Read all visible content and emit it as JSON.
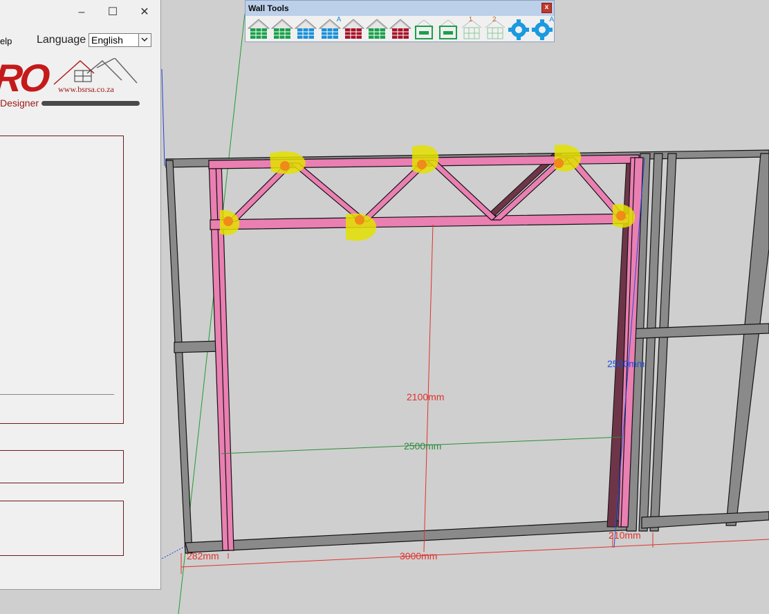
{
  "plugin": {
    "menu_help": "elp",
    "language_label": "Language",
    "language_value": "English",
    "logo_text": "RO",
    "url": "www.bsrsa.co.za",
    "designer": "Designer",
    "window_controls": {
      "minimize": "–",
      "maximize": "☐",
      "close": "✕"
    }
  },
  "walltools": {
    "title": "Wall Tools",
    "close": "x",
    "tools": [
      {
        "name": "wall-green-icon",
        "color": "#1aa04a"
      },
      {
        "name": "wall-green-icon",
        "color": "#1aa04a"
      },
      {
        "name": "wall-blue-icon",
        "color": "#1b8fd6"
      },
      {
        "name": "wall-blue-auto-icon",
        "color": "#1b8fd6",
        "badge": "A"
      },
      {
        "name": "wall-red-icon",
        "color": "#a5142a"
      },
      {
        "name": "wall-green-icon",
        "color": "#1aa04a"
      },
      {
        "name": "wall-red-icon",
        "color": "#a5142a"
      },
      {
        "name": "opening-icon",
        "color": "#1aa04a"
      },
      {
        "name": "window-icon",
        "color": "#1aa04a"
      },
      {
        "name": "grid-1-icon",
        "color": "#8cc79a",
        "badge": "1"
      },
      {
        "name": "grid-2-icon",
        "color": "#8cc79a",
        "badge": "2"
      },
      {
        "name": "gear-icon",
        "color": "#1b9ae0"
      },
      {
        "name": "gear-auto-icon",
        "color": "#1b9ae0",
        "badge": "A"
      }
    ]
  },
  "dimensions": {
    "height_center": "2100mm",
    "width_inner": "2500mm",
    "height_right": "2500mm",
    "width_bottom": "3000mm",
    "offset_left": "282mm",
    "offset_right": "210mm"
  },
  "colors": {
    "frame_grey": "#7d7d7d",
    "frame_pink": "#ea7fb2",
    "highlight_yellow": "#e3e000",
    "highlight_orange": "#f08a1a",
    "dim_red": "#e0312b",
    "dim_green": "#2e8b3a",
    "dim_blue": "#1e50e0"
  }
}
